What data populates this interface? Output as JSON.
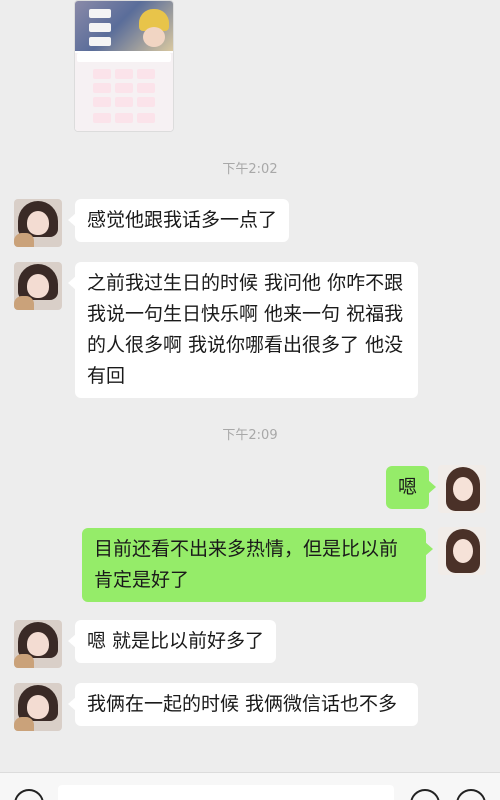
{
  "timestamps": [
    "下午2:02",
    "下午2:09"
  ],
  "image_message": {
    "icon": "keyboard-screenshot-image"
  },
  "messages": [
    {
      "side": "in",
      "text": "感觉他跟我话多一点了"
    },
    {
      "side": "in",
      "text": "之前我过生日的时候 我问他 你咋不跟我说一句生日快乐啊  他来一句 祝福我的人很多啊  我说你哪看出很多了  他没有回"
    },
    {
      "side": "out",
      "text": "嗯"
    },
    {
      "side": "out",
      "text": "目前还看不出来多热情，但是比以前肯定是好了"
    },
    {
      "side": "in",
      "text": "嗯 就是比以前好多了"
    },
    {
      "side": "in",
      "text": "我俩在一起的时候  我俩微信话也不多"
    }
  ],
  "input_bar": {
    "voice_icon": "voice-icon",
    "emoji_icon": "emoji-icon",
    "plus_icon": "plus-icon"
  },
  "colors": {
    "background": "#ededed",
    "incoming": "#ffffff",
    "outgoing": "#95ec69"
  }
}
